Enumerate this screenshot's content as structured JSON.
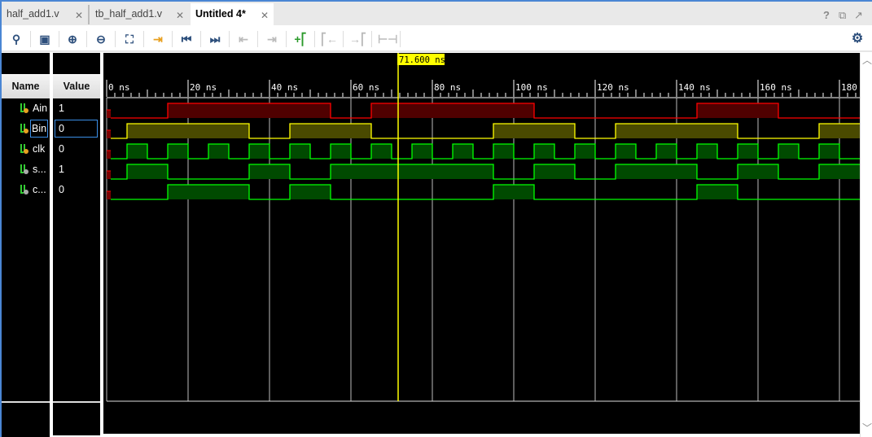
{
  "tabs": [
    {
      "label": "half_add1.v",
      "active": false
    },
    {
      "label": "tb_half_add1.v",
      "active": false
    },
    {
      "label": "Untitled 4*",
      "active": true
    }
  ],
  "window_buttons": {
    "help": "?",
    "restore": "⧉",
    "float": "↗"
  },
  "toolbar": [
    "search-icon",
    "save-icon",
    "zoom-in-icon",
    "zoom-out-icon",
    "zoom-fit-icon",
    "go-to-cursor-icon",
    "go-to-start-icon",
    "go-to-end-icon",
    "previous-transition-icon",
    "next-transition-icon",
    "add-marker-icon",
    "previous-marker-icon",
    "next-marker-icon",
    "swap-cursors-icon",
    "settings-icon"
  ],
  "columns": {
    "name": "Name",
    "value": "Value"
  },
  "signals": [
    {
      "name": "Ain",
      "value": "1",
      "icon": "input-port-icon",
      "color": "#ff0000",
      "fill": "#500000",
      "high": [
        [
          15,
          55
        ],
        [
          65,
          105
        ],
        [
          145,
          165
        ]
      ]
    },
    {
      "name": "Bin",
      "value": "0",
      "icon": "input-port-icon",
      "color": "#ffff00",
      "fill": "#4a4a00",
      "high": [
        [
          5,
          35
        ],
        [
          45,
          65
        ],
        [
          95,
          115
        ],
        [
          125,
          155
        ],
        [
          175,
          185
        ]
      ],
      "selected": true
    },
    {
      "name": "clk",
      "value": "0",
      "icon": "input-port-icon",
      "color": "#00ff00",
      "fill": "#004a00",
      "high": [
        [
          5,
          10
        ],
        [
          15,
          20
        ],
        [
          25,
          30
        ],
        [
          35,
          40
        ],
        [
          45,
          50
        ],
        [
          55,
          60
        ],
        [
          65,
          70
        ],
        [
          75,
          80
        ],
        [
          85,
          90
        ],
        [
          95,
          100
        ],
        [
          105,
          110
        ],
        [
          115,
          120
        ],
        [
          125,
          130
        ],
        [
          135,
          140
        ],
        [
          145,
          150
        ],
        [
          155,
          160
        ],
        [
          165,
          170
        ],
        [
          175,
          180
        ]
      ]
    },
    {
      "name": "s...",
      "value": "1",
      "icon": "output-port-icon",
      "color": "#00ff00",
      "fill": "#004a00",
      "high": [
        [
          5,
          15
        ],
        [
          35,
          45
        ],
        [
          55,
          95
        ],
        [
          105,
          115
        ],
        [
          125,
          145
        ],
        [
          155,
          165
        ],
        [
          175,
          185
        ]
      ]
    },
    {
      "name": "c...",
      "value": "0",
      "icon": "output-port-icon",
      "color": "#00ff00",
      "fill": "#004a00",
      "high": [
        [
          15,
          35
        ],
        [
          45,
          55
        ],
        [
          95,
          105
        ],
        [
          145,
          155
        ]
      ]
    }
  ],
  "timeline": {
    "unit": "ns",
    "major": [
      0,
      20,
      40,
      60,
      80,
      100,
      120,
      140,
      160,
      180
    ],
    "labels": [
      "0 ns",
      "20 ns",
      "40 ns",
      "60 ns",
      "80 ns",
      "100 ns",
      "120 ns",
      "140 ns",
      "160 ns",
      "180"
    ],
    "end": 185
  },
  "cursor": {
    "time": 71.6,
    "label": "71.600 ns",
    "color": "#ffff00"
  }
}
